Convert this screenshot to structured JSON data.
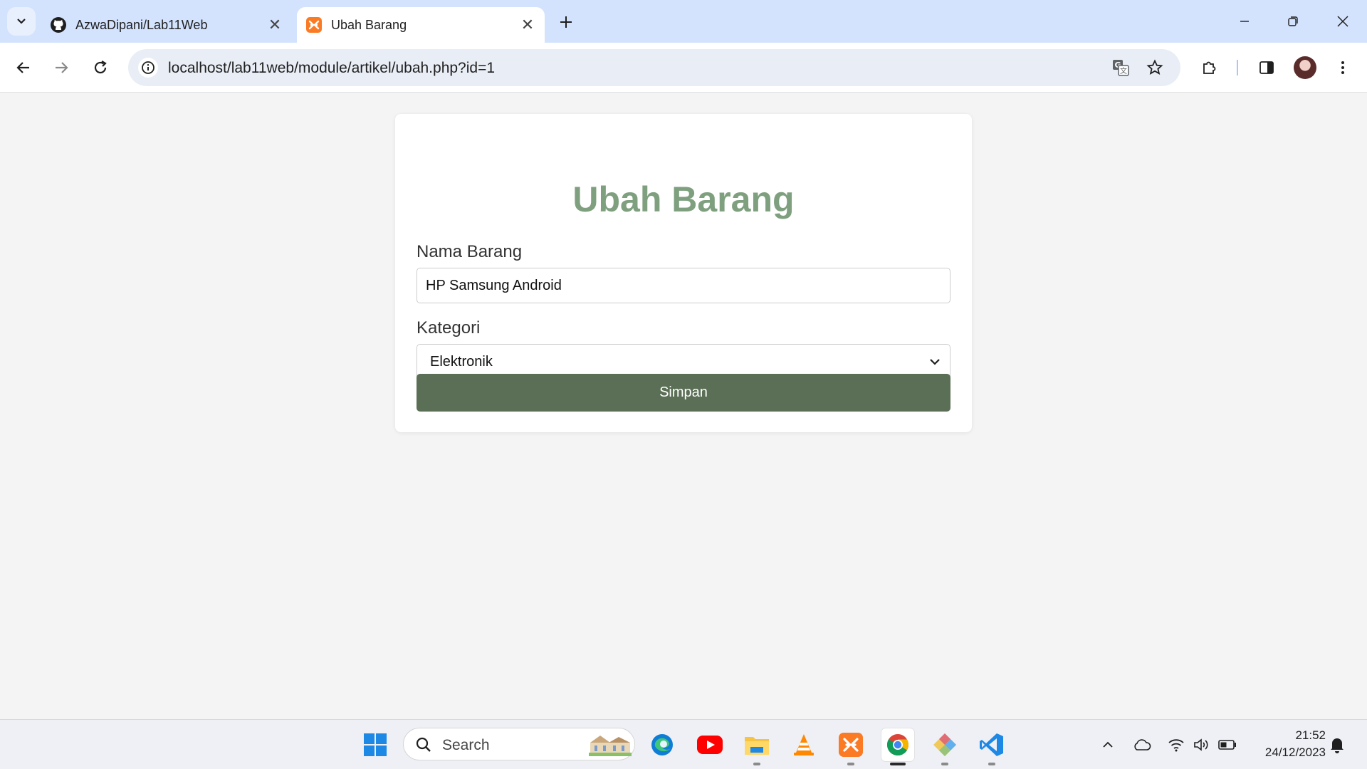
{
  "browser": {
    "tabs": [
      {
        "title": "AzwaDipani/Lab11Web",
        "favicon": "github-icon",
        "active": false
      },
      {
        "title": "Ubah Barang",
        "favicon": "xampp-icon",
        "active": true
      }
    ],
    "address_bar": {
      "url": "localhost/lab11web/module/artikel/ubah.php?id=1"
    },
    "accent_color": "#d3e3fd"
  },
  "form": {
    "heading": "Ubah Barang",
    "name_label": "Nama Barang",
    "name_value": "HP Samsung Android",
    "category_label": "Kategori",
    "category_value": "Elektronik",
    "submit_label": "Simpan",
    "heading_color": "#7fa07f",
    "button_color": "#5b6f56"
  },
  "taskbar": {
    "search_placeholder": "Search",
    "apps": [
      "windows-start",
      "edge",
      "youtube",
      "file-explorer",
      "vlc",
      "xampp",
      "chrome",
      "git",
      "vscode"
    ],
    "time": "21:52",
    "date": "24/12/2023"
  }
}
